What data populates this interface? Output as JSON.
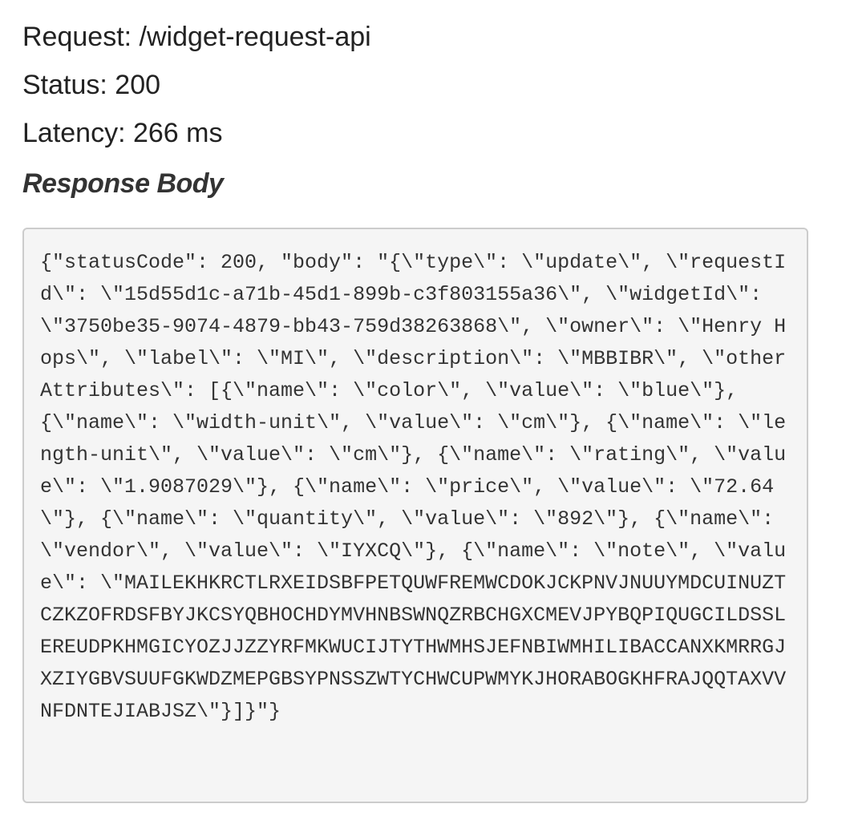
{
  "request": {
    "label": "Request:",
    "path": "/widget-request-api"
  },
  "status": {
    "label": "Status:",
    "code": "200"
  },
  "latency": {
    "label": "Latency:",
    "value": "266 ms"
  },
  "response": {
    "heading": "Response Body",
    "body": "{\"statusCode\": 200, \"body\": \"{\\\"type\\\": \\\"update\\\", \\\"requestId\\\": \\\"15d55d1c-a71b-45d1-899b-c3f803155a36\\\", \\\"widgetId\\\": \\\"3750be35-9074-4879-bb43-759d38263868\\\", \\\"owner\\\": \\\"Henry Hops\\\", \\\"label\\\": \\\"MI\\\", \\\"description\\\": \\\"MBBIBR\\\", \\\"otherAttributes\\\": [{\\\"name\\\": \\\"color\\\", \\\"value\\\": \\\"blue\\\"}, {\\\"name\\\": \\\"width-unit\\\", \\\"value\\\": \\\"cm\\\"}, {\\\"name\\\": \\\"length-unit\\\", \\\"value\\\": \\\"cm\\\"}, {\\\"name\\\": \\\"rating\\\", \\\"value\\\": \\\"1.9087029\\\"}, {\\\"name\\\": \\\"price\\\", \\\"value\\\": \\\"72.64\\\"}, {\\\"name\\\": \\\"quantity\\\", \\\"value\\\": \\\"892\\\"}, {\\\"name\\\": \\\"vendor\\\", \\\"value\\\": \\\"IYXCQ\\\"}, {\\\"name\\\": \\\"note\\\", \\\"value\\\": \\\"MAILEKHKRCTLRXEIDSBFPETQUWFREMWCDOKJCKPNVJNUUYMDCUINUZTCZKZOFRDSFBYJKCSYQBHOCHDYMVHNBSWNQZRBCHGXCMEVJPYBQPIQUGCILDSSLEREUDPKHMGICYOZJJZZYRFMKWUCIJTYTHWMHSJEFNBIWMHILIBACCANXKMRRGJXZIYGBVSUUFGKWDZMEPGBSYPNSSZWTYCHWCUPWMYKJHORABOGKHFRAJQQTAXVVNFDNTEJIABJSZ\\\"}]}\"}"
  }
}
